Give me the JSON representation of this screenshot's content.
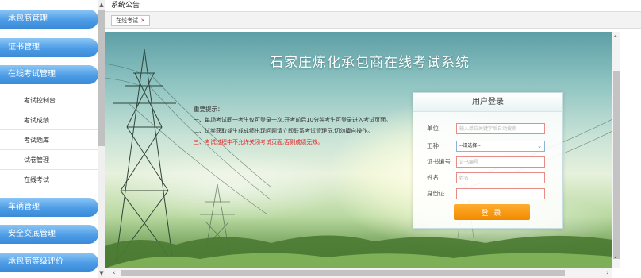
{
  "sidebar": {
    "menus": [
      {
        "label": "承包商管理"
      },
      {
        "label": "证书管理"
      },
      {
        "label": "在线考试管理"
      },
      {
        "label": "车辆管理"
      },
      {
        "label": "安全交底管理"
      },
      {
        "label": "承包商等级评价"
      }
    ],
    "subitems": [
      {
        "label": "考试控制台"
      },
      {
        "label": "考试成绩"
      },
      {
        "label": "考试题库"
      },
      {
        "label": "试卷管理"
      },
      {
        "label": "在线考试"
      }
    ]
  },
  "header": {
    "title": "系统公告",
    "tab_label": "在线考试",
    "tab_close": "✕"
  },
  "content": {
    "system_title": "石家庄炼化承包商在线考试系统",
    "notice": {
      "title": "重要提示：",
      "lines": [
        "一、每场考试同一考生仅可登录一次,开考前后10分钟考生可登录进入考试页面。",
        "二、试卷获取或生成成绩出现问题请立即联系考试管理员,切勿擅自操作。",
        "三、考试过程中不允许关闭考试页面,否则成绩无效。"
      ]
    },
    "login": {
      "title": "用户登录",
      "fields": {
        "unit": {
          "label": "单位",
          "placeholder": "输入单位关键字后自动搜索"
        },
        "job": {
          "label": "工种",
          "value": "--请选择--"
        },
        "cert": {
          "label": "证书编号",
          "placeholder": "证书编号"
        },
        "name": {
          "label": "姓名",
          "placeholder": "姓名"
        },
        "id": {
          "label": "身份证",
          "placeholder": ""
        }
      },
      "button": "登 录"
    }
  },
  "colors": {
    "menu_blue": "#4d9ce6",
    "login_button": "#f18a00",
    "notice_red": "#e02020"
  }
}
